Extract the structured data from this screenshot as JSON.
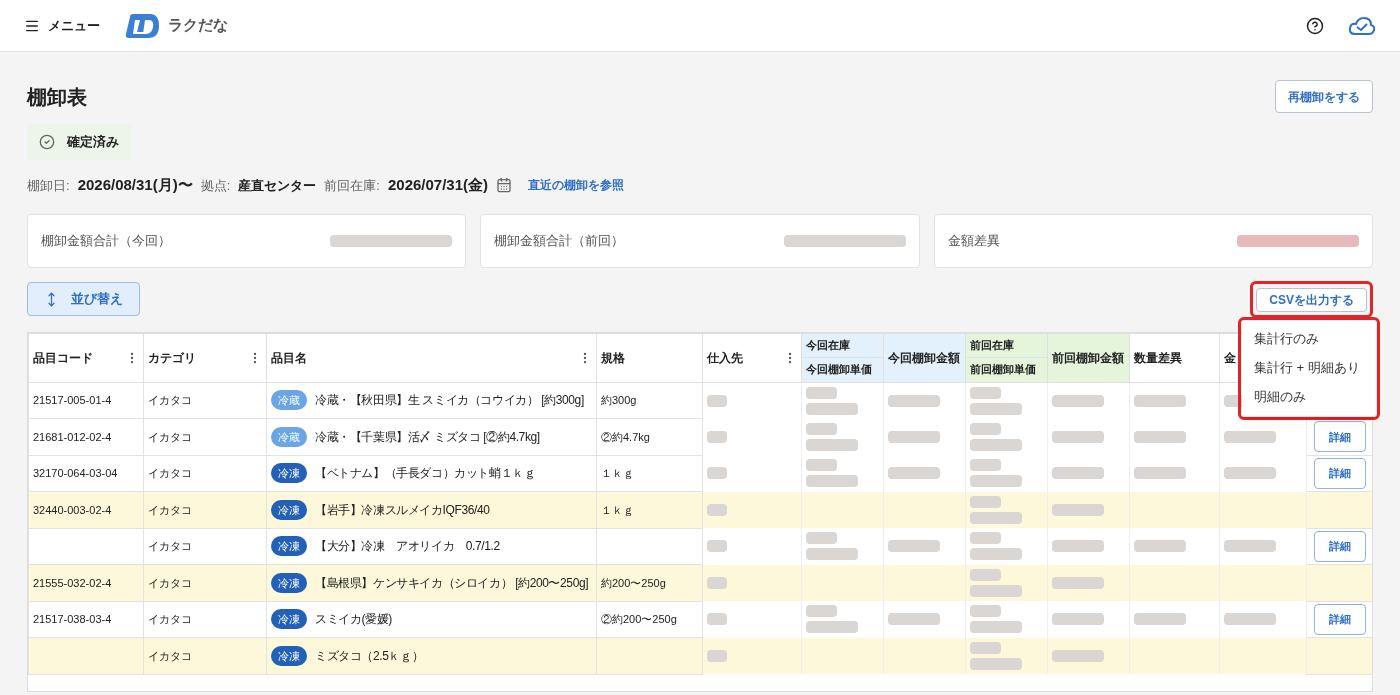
{
  "header": {
    "menu_label": "メニュー",
    "app_name": "ラクだな"
  },
  "page": {
    "title": "棚卸表",
    "reinventory_button": "再棚卸をする",
    "status": {
      "label": "確定済み"
    }
  },
  "info": {
    "items": [
      {
        "label": "棚卸日:",
        "value": "2026/08/31(月)〜"
      },
      {
        "label": "拠点:",
        "value": "産直センター"
      },
      {
        "label": "前回在庫:",
        "value": "2026/07/31(金)"
      }
    ],
    "link": "直近の棚卸を参照"
  },
  "summary_cards": [
    {
      "label": "棚卸金額合計（今回）",
      "kind": "neutral"
    },
    {
      "label": "棚卸金額合計（前回）",
      "kind": "neutral"
    },
    {
      "label": "金額差異",
      "kind": "negative"
    }
  ],
  "toolbar": {
    "sort_button": "並び替え",
    "csv_button": "CSVを出力する",
    "csv_highlighted": true
  },
  "csv_menu": {
    "highlighted": true,
    "items": [
      "集計行のみ",
      "集計行 + 明細あり",
      "明細のみ"
    ]
  },
  "table": {
    "columns": [
      {
        "label": "品目コード",
        "menu": true,
        "kind": "plain"
      },
      {
        "label": "カテゴリ",
        "menu": true,
        "kind": "plain"
      },
      {
        "label": "品目名",
        "menu": true,
        "kind": "plain"
      },
      {
        "label": "規格",
        "kind": "plain"
      },
      {
        "label": "仕入先",
        "menu": true,
        "kind": "plain"
      },
      {
        "label": "今回在庫",
        "sublabel": "今回棚卸単価",
        "kind": "current"
      },
      {
        "label": "今回棚卸金額",
        "kind": "current"
      },
      {
        "label": "前回在庫",
        "sublabel": "前回棚卸単価",
        "kind": "previous"
      },
      {
        "label": "前回棚卸金額",
        "kind": "previous"
      },
      {
        "label": "数量差異",
        "kind": "plain"
      },
      {
        "label": "金",
        "kind": "plain"
      }
    ],
    "rows": [
      {
        "code": "21517-005-01-4",
        "category": "イカタコ",
        "storage": {
          "label": "冷蔵",
          "kind": "chilled"
        },
        "name": "冷蔵・【秋田県】生 スミイカ（コウイカ） [約300g]",
        "spec": "約300g",
        "highlighted": false
      },
      {
        "code": "21681-012-02-4",
        "category": "イカタコ",
        "storage": {
          "label": "冷蔵",
          "kind": "chilled"
        },
        "name": "冷蔵・【千葉県】活〆 ミズタコ [②約4.7kg]",
        "spec": "②約4.7kg",
        "highlighted": false,
        "detail_button": "詳細"
      },
      {
        "code": "32170-064-03-04",
        "category": "イカタコ",
        "storage": {
          "label": "冷凍",
          "kind": "frozen"
        },
        "name": "【ベトナム】（手長ダコ）カット蛸１ｋｇ",
        "spec": "１ｋｇ",
        "highlighted": false,
        "detail_button": "詳細"
      },
      {
        "code": "32440-003-02-4",
        "category": "イカタコ",
        "storage": {
          "label": "冷凍",
          "kind": "frozen"
        },
        "name": "【岩手】冷凍スルメイカIQF36/40",
        "spec": "１ｋｇ",
        "highlighted": true
      },
      {
        "category": "イカタコ",
        "storage": {
          "label": "冷凍",
          "kind": "frozen"
        },
        "name": "【大分】冷凍　アオリイカ　0.7/1.2",
        "highlighted": false,
        "detail_button": "詳細"
      },
      {
        "code": "21555-032-02-4",
        "category": "イカタコ",
        "storage": {
          "label": "冷凍",
          "kind": "frozen"
        },
        "name": "【島根県】ケンサキイカ（シロイカ） [約200〜250g]",
        "spec": "約200〜250g",
        "highlighted": true
      },
      {
        "code": "21517-038-03-4",
        "category": "イカタコ",
        "storage": {
          "label": "冷凍",
          "kind": "frozen"
        },
        "name": "スミイカ(愛媛)",
        "spec": "②約200〜250g",
        "highlighted": false,
        "detail_button": "詳細"
      },
      {
        "category": "イカタコ",
        "storage": {
          "label": "冷凍",
          "kind": "frozen"
        },
        "name": "ミズタコ（2.5ｋｇ）",
        "highlighted": true
      }
    ]
  }
}
